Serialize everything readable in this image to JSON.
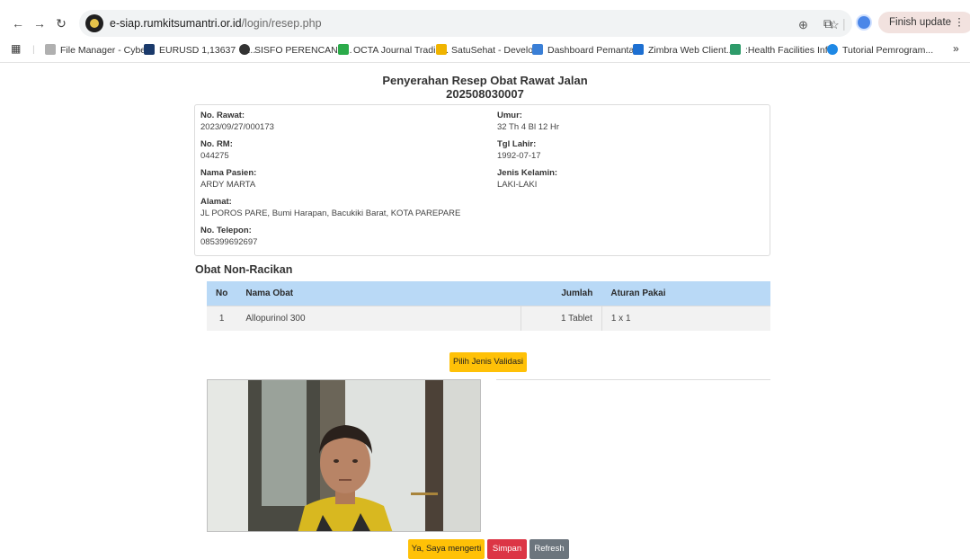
{
  "browser": {
    "url_domain": "e-siap.rumkitsumantri.or.id",
    "url_path": "/login/resep.php",
    "finish_update_label": "Finish update",
    "bookmarks": [
      {
        "label": "File Manager - Cybe...",
        "color": "#b0b0b0"
      },
      {
        "label": "EURUSD 1,13637 ▼...",
        "color": "#1a3a6b"
      },
      {
        "label": "SISFO PERENCANA...",
        "color": "#333333"
      },
      {
        "label": "OCTA Journal Tradin...",
        "color": "#2bab4a"
      },
      {
        "label": "SatuSehat - Develo...",
        "color": "#f0b400"
      },
      {
        "label": "Dashboard Pemanta...",
        "color": "#3a7fd6"
      },
      {
        "label": "Zimbra Web Client...",
        "color": "#1d6fd1"
      },
      {
        "label": ":Health Facilities Inf...",
        "color": "#2e9b6a"
      },
      {
        "label": "Tutorial Pemrogram...",
        "color": "#1e88e5"
      }
    ]
  },
  "page": {
    "title": "Penyerahan Resep Obat Rawat Jalan",
    "code": "202508030007"
  },
  "patient": {
    "no_rawat_label": "No. Rawat:",
    "no_rawat": "2023/09/27/000173",
    "no_rm_label": "No. RM:",
    "no_rm": "044275",
    "nama_label": "Nama Pasien:",
    "nama": "ARDY MARTA",
    "alamat_label": "Alamat:",
    "alamat": "JL POROS PARE, Bumi Harapan, Bacukiki Barat, KOTA PAREPARE",
    "telepon_label": "No. Telepon:",
    "telepon": "085399692697",
    "umur_label": "Umur:",
    "umur": "32 Th 4 Bl 12 Hr",
    "tgl_lahir_label": "Tgl Lahir:",
    "tgl_lahir": "1992-07-17",
    "jenis_kelamin_label": "Jenis Kelamin:",
    "jenis_kelamin": "LAKI-LAKI"
  },
  "obat": {
    "section_title": "Obat Non-Racikan",
    "headers": {
      "no": "No",
      "nama": "Nama Obat",
      "jumlah": "Jumlah",
      "aturan": "Aturan Pakai"
    },
    "rows": [
      {
        "no": "1",
        "nama": "Allopurinol 300",
        "jumlah": "1 Tablet",
        "aturan": "1 x 1"
      }
    ]
  },
  "actions": {
    "pilih_validasi": "Pilih Jenis Validasi",
    "mengerti": "Ya, Saya mengerti",
    "simpan": "Simpan",
    "refresh": "Refresh"
  },
  "colors": {
    "table_header": "#b9d9f6",
    "warning": "#ffc107",
    "danger": "#dc3545",
    "secondary": "#6c757d"
  }
}
